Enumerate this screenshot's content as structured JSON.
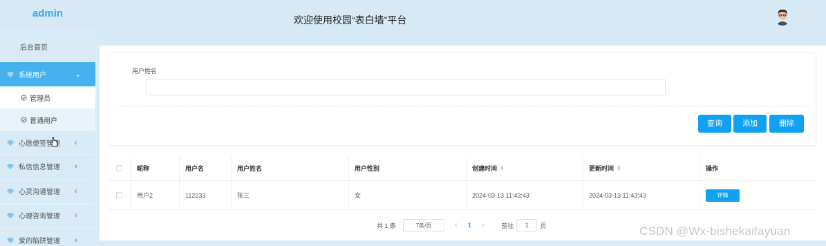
{
  "header": {
    "brand": "admin",
    "welcome": "欢迎使用校园“表白墙”平台"
  },
  "sidebar": {
    "home": "后台首页",
    "items": [
      {
        "label": "系统用户",
        "expanded": true
      },
      {
        "label": "心愿便签管理"
      },
      {
        "label": "私信信息管理"
      },
      {
        "label": "心灵沟通管理"
      },
      {
        "label": "心理咨询管理"
      },
      {
        "label": "爱的陷阱管理"
      }
    ],
    "subitems": [
      "管理员",
      "普通用户"
    ]
  },
  "search": {
    "field_label": "用户姓名",
    "field_value": "",
    "buttons": {
      "query": "查询",
      "add": "添加",
      "delete": "删除"
    }
  },
  "table": {
    "columns": [
      "昵称",
      "用户名",
      "用户姓名",
      "用户性别",
      "创建时间",
      "更新时间",
      "操作"
    ],
    "rows": [
      {
        "nickname": "用户2",
        "username": "112233",
        "realname": "张三",
        "gender": "女",
        "created": "2024-03-13 11:43:43",
        "updated": "2024-03-13 11:43:43",
        "action": "详情"
      }
    ]
  },
  "pagination": {
    "total": "共 1 条",
    "page_size": "7条/页",
    "current": "1",
    "goto_label": "前往",
    "goto_value": "1",
    "page_suffix": "页"
  },
  "watermark": "CSDN @Wx-bishekaifayuan",
  "colors": {
    "accent": "#10a1f3",
    "sidebar_active": "#45b1ef",
    "background": "#d9ebf6"
  }
}
